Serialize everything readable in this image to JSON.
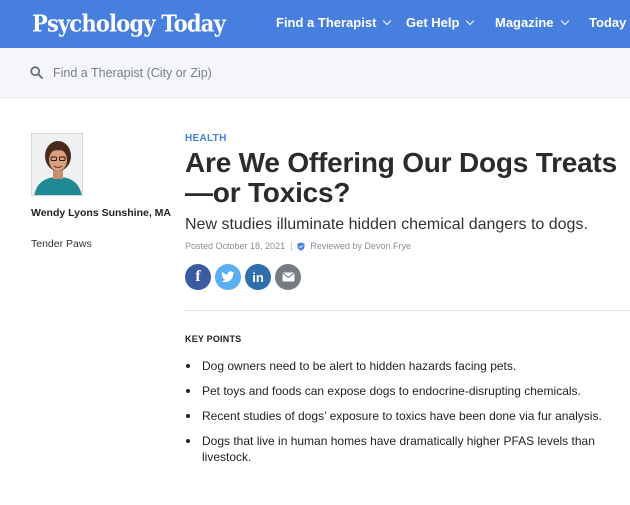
{
  "header": {
    "logo": "Psychology Today",
    "nav": [
      {
        "label": "Find a Therapist"
      },
      {
        "label": "Get Help"
      },
      {
        "label": "Magazine"
      },
      {
        "label": "Today"
      }
    ]
  },
  "search": {
    "placeholder": "Find a Therapist (City or Zip)",
    "icon": "search-icon"
  },
  "author": {
    "name": "Wendy Lyons Sunshine, MA",
    "blog": "Tender Paws"
  },
  "article": {
    "category": "HEALTH",
    "title": "Are We Offering Our Dogs Treats—or Toxics?",
    "subtitle": "New studies illuminate hidden chemical dangers to dogs.",
    "posted": "Posted October 18, 2021",
    "separator": "|",
    "reviewed": "Reviewed by Devon Frye"
  },
  "social": {
    "facebook_glyph": "f",
    "linkedin_glyph": "in",
    "colors": {
      "facebook": "#3a5ba0",
      "twitter": "#5aaef2",
      "linkedin": "#2f6fac",
      "email": "#777b82"
    }
  },
  "key_points": {
    "heading": "KEY POINTS",
    "items": [
      "Dog owners need to be alert to hidden hazards facing pets.",
      "Pet toys and foods can expose dogs to endocrine-disrupting chemicals.",
      "Recent studies of dogs’ exposure to toxics have been done via fur analysis.",
      "Dogs that live in human homes have dramatically higher PFAS levels than livestock."
    ]
  },
  "colors": {
    "brand": "#477fdf",
    "accent_text": "#477fdf"
  }
}
